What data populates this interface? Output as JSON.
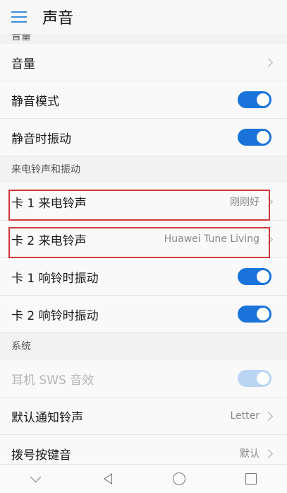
{
  "header": {
    "title": "声音"
  },
  "sections": {
    "volume_cut": "音量",
    "ringtone": "来电铃声和振动",
    "system": "系统"
  },
  "rows": {
    "volume": {
      "label": "音量"
    },
    "silent_mode": {
      "label": "静音模式",
      "on": true
    },
    "vibrate_silent": {
      "label": "静音时振动",
      "on": true
    },
    "sim1_ringtone": {
      "label": "卡 1 来电铃声",
      "value": "刚刚好"
    },
    "sim2_ringtone": {
      "label": "卡 2 来电铃声",
      "value": "Huawei Tune Living"
    },
    "sim1_vibrate": {
      "label": "卡 1 响铃时振动",
      "on": true
    },
    "sim2_vibrate": {
      "label": "卡 2 响铃时振动",
      "on": true
    },
    "earphone_sws": {
      "label": "耳机 SWS 音效",
      "on": true,
      "disabled": true
    },
    "notification_tone": {
      "label": "默认通知铃声",
      "value": "Letter"
    },
    "dial_tone": {
      "label": "拨号按键音",
      "value": "默认"
    }
  },
  "colors": {
    "accent": "#1a73d9",
    "highlight": "#d03a3a"
  }
}
